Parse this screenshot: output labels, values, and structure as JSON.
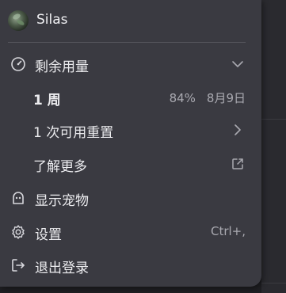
{
  "user": {
    "name": "Silas"
  },
  "usage": {
    "label": "剩余用量",
    "period_label": "1 周",
    "percent": "84%",
    "reset_date": "8月9日",
    "reset_option_label": "1 次可用重置"
  },
  "menu": {
    "learn_more_label": "了解更多",
    "show_pet_label": "显示宠物",
    "settings_label": "设置",
    "settings_shortcut": "Ctrl+,",
    "logout_label": "退出登录"
  },
  "icons": {
    "usage": "gauge-icon",
    "usage_toggle": "chevron-down-icon",
    "reset_arrow": "chevron-right-icon",
    "learn_more": "external-link-icon",
    "pet": "ghost-icon",
    "settings": "gear-icon",
    "logout": "logout-icon"
  },
  "colors": {
    "menu_bg": "#3a3a41",
    "text": "#ececef",
    "muted": "#a9a9b0"
  }
}
